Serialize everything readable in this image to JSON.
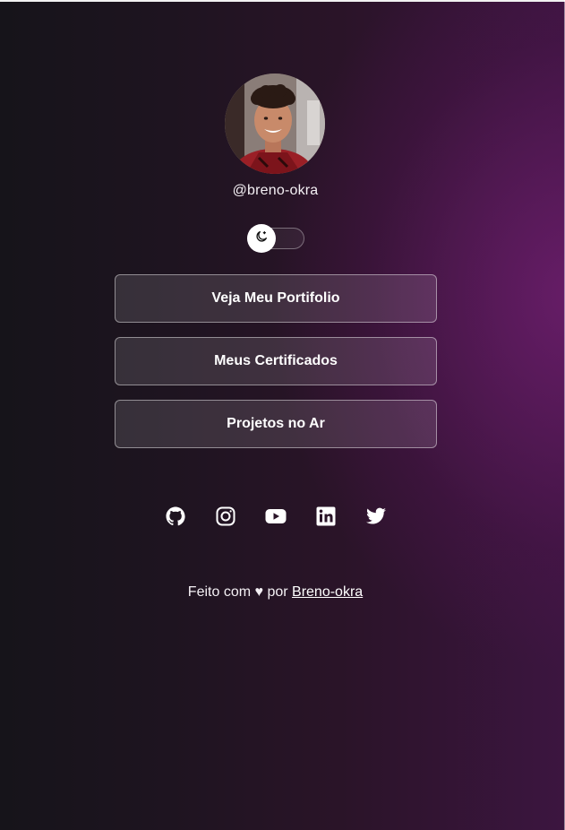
{
  "profile": {
    "username": "@breno-okra",
    "avatar_alt": "profile photo"
  },
  "theme_toggle": {
    "icon": "moon-icon",
    "state": "dark"
  },
  "links": [
    {
      "label": "Veja Meu Portifolio"
    },
    {
      "label": "Meus Certificados"
    },
    {
      "label": "Projetos no Ar"
    }
  ],
  "socials": [
    {
      "icon": "github-icon"
    },
    {
      "icon": "instagram-icon"
    },
    {
      "icon": "youtube-icon"
    },
    {
      "icon": "linkedin-icon"
    },
    {
      "icon": "twitter-icon"
    }
  ],
  "footer": {
    "prefix": "Feito com",
    "heart": "♥",
    "by": "por",
    "author_link": "Breno-okra"
  },
  "colors": {
    "text": "#ffffff",
    "background_dark": "#16141a",
    "background_accent": "#4a1a4e"
  }
}
